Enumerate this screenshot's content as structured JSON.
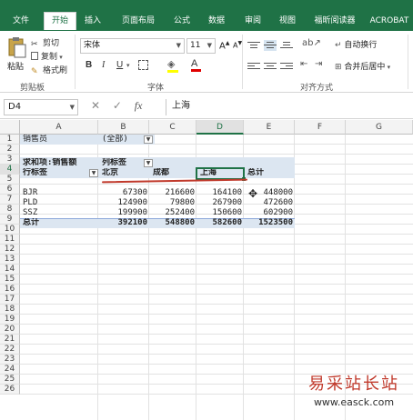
{
  "ribbon": {
    "tabs": [
      "文件",
      "开始",
      "插入",
      "页面布局",
      "公式",
      "数据",
      "审阅",
      "视图",
      "福昕阅读器",
      "ACROBAT"
    ],
    "active_tab": "开始",
    "clipboard": {
      "paste": "粘贴",
      "cut": "剪切",
      "copy": "复制",
      "format_painter": "格式刷",
      "group_label": "剪贴板"
    },
    "font": {
      "name": "宋体",
      "size": "11",
      "bold": "B",
      "italic": "I",
      "underline": "U",
      "group_label": "字体"
    },
    "alignment": {
      "wrap_text": "自动换行",
      "merge_center": "合并后居中",
      "group_label": "对齐方式"
    }
  },
  "formula_bar": {
    "name_box": "D4",
    "fx": "fx",
    "value": "上海"
  },
  "grid": {
    "columns": [
      "A",
      "B",
      "C",
      "D",
      "E",
      "F",
      "G"
    ],
    "selected_column": "D",
    "rows": [
      "1",
      "2",
      "3",
      "4",
      "5",
      "6",
      "7",
      "8",
      "9",
      "10",
      "11",
      "12",
      "13",
      "14",
      "15",
      "16",
      "17",
      "18",
      "19",
      "20",
      "21",
      "22",
      "23",
      "24",
      "25",
      "26"
    ],
    "selected_row": "4"
  },
  "pivot": {
    "filter_label": "销售员",
    "filter_value": "(全部)",
    "value_title": "求和项:销售额",
    "col_labels": "列标签",
    "row_labels": "行标签",
    "col_headers": [
      "北京",
      "成都",
      "上海",
      "总计"
    ],
    "rows": [
      {
        "label": "BJR",
        "values": [
          "67300",
          "216600",
          "164100",
          "448000"
        ]
      },
      {
        "label": "PLD",
        "values": [
          "124900",
          "79800",
          "267900",
          "472600"
        ]
      },
      {
        "label": "SSZ",
        "values": [
          "199900",
          "252400",
          "150600",
          "602900"
        ]
      }
    ],
    "total_label": "总计",
    "totals": [
      "392100",
      "548800",
      "582600",
      "1523500"
    ]
  },
  "watermark": {
    "title": "易采站长站",
    "url": "www.easck.com"
  },
  "colors": {
    "ribbon_green": "#1f7246",
    "pivot_header": "#dce6f1",
    "annotation_red": "#c0392b"
  }
}
